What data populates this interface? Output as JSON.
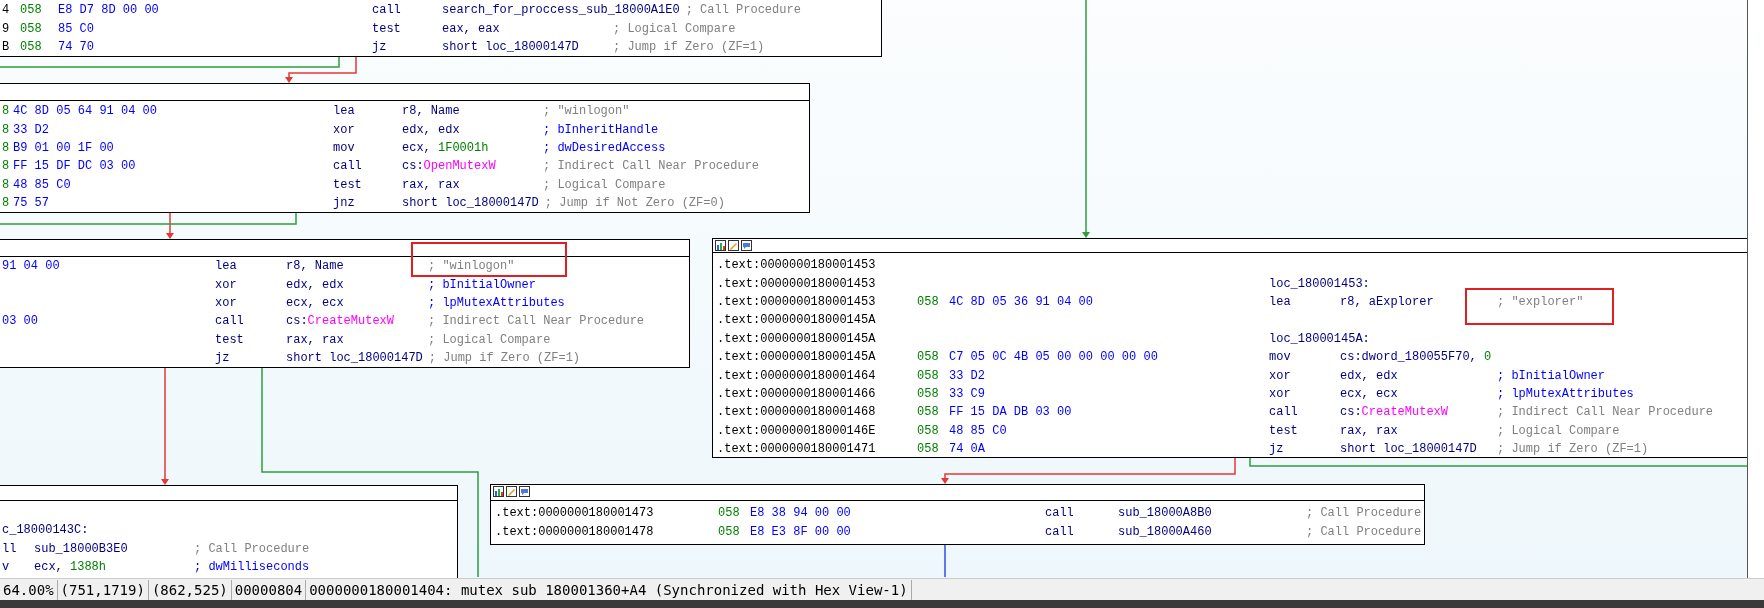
{
  "graph": {
    "blocks": [
      {
        "lines": [
          {
            "address": "4",
            "stack": "058",
            "bytes": "E8 D7 8D 00 00",
            "mnemonic": "call",
            "operands": [
              {
                "kind": "name",
                "text": "search_for_proccess_sub_18000A1E0"
              }
            ],
            "comment": {
              "kind": "auto",
              "text": "; Call Procedure"
            }
          },
          {
            "address": "9",
            "stack": "058",
            "bytes": "85 C0",
            "mnemonic": "test",
            "operands": [
              {
                "kind": "name",
                "text": "eax, eax"
              }
            ],
            "comment": {
              "kind": "auto",
              "text": "; Logical Compare"
            }
          },
          {
            "address": "B",
            "stack": "058",
            "bytes": "74 70",
            "mnemonic": "jz",
            "operands": [
              {
                "kind": "name",
                "text": "short loc_18000147D"
              }
            ],
            "comment": {
              "kind": "auto",
              "text": "; Jump if Zero (ZF=1)"
            }
          }
        ]
      },
      {
        "lines": [
          {
            "stack": "8",
            "bytes": "4C 8D 05 64 91 04 00",
            "mnemonic": "lea",
            "operands": [
              {
                "kind": "name",
                "text": "r8, Name"
              }
            ],
            "comment": {
              "kind": "auto",
              "text": "; \"winlogon\""
            }
          },
          {
            "stack": "8",
            "bytes": "33 D2",
            "mnemonic": "xor",
            "operands": [
              {
                "kind": "name",
                "text": "edx, edx"
              }
            ],
            "comment": {
              "kind": "param",
              "text": "; bInheritHandle"
            }
          },
          {
            "stack": "8",
            "bytes": "B9 01 00 1F 00",
            "mnemonic": "mov",
            "operands": [
              {
                "kind": "name",
                "text": "ecx, "
              },
              {
                "kind": "number",
                "text": "1F0001h"
              }
            ],
            "comment": {
              "kind": "param",
              "text": "; dwDesiredAccess"
            }
          },
          {
            "stack": "8",
            "bytes": "FF 15 DF DC 03 00",
            "mnemonic": "call",
            "operands": [
              {
                "kind": "name",
                "text": "cs:"
              },
              {
                "kind": "import",
                "text": "OpenMutexW"
              }
            ],
            "comment": {
              "kind": "auto",
              "text": "; Indirect Call Near Procedure"
            }
          },
          {
            "stack": "8",
            "bytes": "48 85 C0",
            "mnemonic": "test",
            "operands": [
              {
                "kind": "name",
                "text": "rax, rax"
              }
            ],
            "comment": {
              "kind": "auto",
              "text": "; Logical Compare"
            }
          },
          {
            "stack": "8",
            "bytes": "75 57",
            "mnemonic": "jnz",
            "operands": [
              {
                "kind": "name",
                "text": "short loc_18000147D"
              }
            ],
            "comment": {
              "kind": "auto",
              "text": "; Jump if Not Zero (ZF=0)"
            }
          }
        ]
      },
      {
        "lines": [
          {
            "bytes": "91 04 00",
            "mnemonic": "lea",
            "operands": [
              {
                "kind": "name",
                "text": "r8, Name"
              }
            ],
            "comment": {
              "kind": "auto",
              "text": "; \"winlogon\""
            }
          },
          {
            "mnemonic": "xor",
            "operands": [
              {
                "kind": "name",
                "text": "edx, edx"
              }
            ],
            "comment": {
              "kind": "param",
              "text": "; bInitialOwner"
            }
          },
          {
            "mnemonic": "xor",
            "operands": [
              {
                "kind": "name",
                "text": "ecx, ecx"
              }
            ],
            "comment": {
              "kind": "param",
              "text": "; lpMutexAttributes"
            }
          },
          {
            "bytes": "03 00",
            "mnemonic": "call",
            "operands": [
              {
                "kind": "name",
                "text": "cs:"
              },
              {
                "kind": "import",
                "text": "CreateMutexW"
              }
            ],
            "comment": {
              "kind": "auto",
              "text": "; Indirect Call Near Procedure"
            }
          },
          {
            "mnemonic": "test",
            "operands": [
              {
                "kind": "name",
                "text": "rax, rax"
              }
            ],
            "comment": {
              "kind": "auto",
              "text": "; Logical Compare"
            }
          },
          {
            "mnemonic": "jz",
            "operands": [
              {
                "kind": "name",
                "text": "short loc_18000147D"
              }
            ],
            "comment": {
              "kind": "auto",
              "text": "; Jump if Zero (ZF=1)"
            }
          }
        ]
      },
      {
        "header_icons": true,
        "lines": [
          {
            "address": ".text:0000000180001453"
          },
          {
            "address": ".text:0000000180001453",
            "label": "loc_180001453:"
          },
          {
            "address": ".text:0000000180001453",
            "stack": "058",
            "bytes": "4C 8D 05 36 91 04 00",
            "mnemonic": "lea",
            "operands": [
              {
                "kind": "name",
                "text": "r8, aExplorer"
              }
            ],
            "comment": {
              "kind": "auto",
              "text": "; \"explorer\""
            }
          },
          {
            "address": ".text:000000018000145A"
          },
          {
            "address": ".text:000000018000145A",
            "label": "loc_18000145A:"
          },
          {
            "address": ".text:000000018000145A",
            "stack": "058",
            "bytes": "C7 05 0C 4B 05 00 00 00 00 00",
            "mnemonic": "mov",
            "operands": [
              {
                "kind": "name",
                "text": "cs:dword_180055F70, "
              },
              {
                "kind": "number",
                "text": "0"
              }
            ]
          },
          {
            "address": ".text:0000000180001464",
            "stack": "058",
            "bytes": "33 D2",
            "mnemonic": "xor",
            "operands": [
              {
                "kind": "name",
                "text": "edx, edx"
              }
            ],
            "comment": {
              "kind": "param",
              "text": "; bInitialOwner"
            }
          },
          {
            "address": ".text:0000000180001466",
            "stack": "058",
            "bytes": "33 C9",
            "mnemonic": "xor",
            "operands": [
              {
                "kind": "name",
                "text": "ecx, ecx"
              }
            ],
            "comment": {
              "kind": "param",
              "text": "; lpMutexAttributes"
            }
          },
          {
            "address": ".text:0000000180001468",
            "stack": "058",
            "bytes": "FF 15 DA DB 03 00",
            "mnemonic": "call",
            "operands": [
              {
                "kind": "name",
                "text": "cs:"
              },
              {
                "kind": "import",
                "text": "CreateMutexW"
              }
            ],
            "comment": {
              "kind": "auto",
              "text": "; Indirect Call Near Procedure"
            }
          },
          {
            "address": ".text:000000018000146E",
            "stack": "058",
            "bytes": "48 85 C0",
            "mnemonic": "test",
            "operands": [
              {
                "kind": "name",
                "text": "rax, rax"
              }
            ],
            "comment": {
              "kind": "auto",
              "text": "; Logical Compare"
            }
          },
          {
            "address": ".text:0000000180001471",
            "stack": "058",
            "bytes": "74 0A",
            "mnemonic": "jz",
            "operands": [
              {
                "kind": "name",
                "text": "short loc_18000147D"
              }
            ],
            "comment": {
              "kind": "auto",
              "text": "; Jump if Zero (ZF=1)"
            }
          }
        ]
      },
      {
        "lines": [
          {
            "label": "c_18000143C:"
          },
          {
            "mnemonic": "ll",
            "operands": [
              {
                "kind": "name",
                "text": "sub_18000B3E0"
              }
            ],
            "comment": {
              "kind": "auto",
              "text": "; Call Procedure"
            }
          },
          {
            "mnemonic": "v",
            "operands": [
              {
                "kind": "name",
                "text": "ecx, "
              },
              {
                "kind": "number",
                "text": "1388h"
              }
            ],
            "comment": {
              "kind": "param",
              "text": "; dwMilliseconds"
            }
          }
        ]
      },
      {
        "header_icons": true,
        "lines": [
          {
            "address": ".text:0000000180001473",
            "stack": "058",
            "bytes": "E8 38 94 00 00",
            "mnemonic": "call",
            "operands": [
              {
                "kind": "name",
                "text": "sub_18000A8B0"
              }
            ],
            "comment": {
              "kind": "auto",
              "text": "; Call Procedure"
            }
          },
          {
            "address": ".text:0000000180001478",
            "stack": "058",
            "bytes": "E8 E3 8F 00 00",
            "mnemonic": "call",
            "operands": [
              {
                "kind": "name",
                "text": "sub_18000A460"
              }
            ],
            "comment": {
              "kind": "auto",
              "text": "; Call Procedure"
            }
          }
        ]
      }
    ]
  },
  "status_bar": [
    "64.00%",
    "(751,1719)",
    "(862,525)",
    "00000804",
    "0000000180001404: mutex sub 180001360+A4 (Synchronized with Hex View-1)"
  ]
}
